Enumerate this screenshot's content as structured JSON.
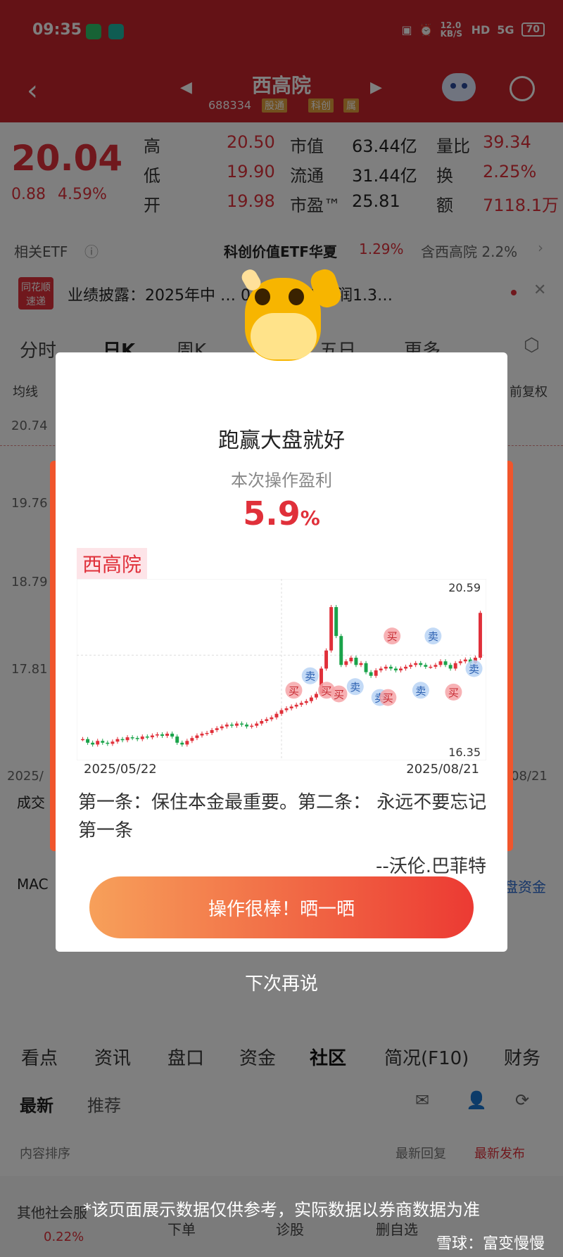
{
  "status_bar": {
    "time": "09:35",
    "net_speed": "12.0 KB/S",
    "network": "5G",
    "battery": "70"
  },
  "header": {
    "title": "西高院",
    "code": "688334",
    "tags": [
      "股通",
      "科创",
      "属"
    ]
  },
  "quote": {
    "price": "20.04",
    "change": "0.88",
    "change_pct": "4.59%",
    "rows": [
      {
        "l1": "高",
        "v1": "20.50",
        "l2": "市值",
        "v2": "63.44亿",
        "l3": "量比",
        "v3": "39.34"
      },
      {
        "l1": "低",
        "v1": "19.90",
        "l2": "流通",
        "v2": "31.44亿",
        "l3": "换",
        "v3": "2.25%"
      },
      {
        "l1": "开",
        "v1": "19.98",
        "l2": "市盈™",
        "v2": "25.81",
        "l3": "额",
        "v3": "7118.1万"
      }
    ]
  },
  "etf": {
    "label": "相关ETF",
    "name": "科创价值ETF华夏",
    "pct": "1.29%",
    "hold": "含西高院  2.2%"
  },
  "news": {
    "logo": "同花顺 速递",
    "text": "业绩披露：2025年中 … 0.42元，净利润1.3…"
  },
  "ktabs": [
    "分时",
    "日K",
    "周K",
    "五日",
    "更多"
  ],
  "sub": {
    "left": "均线",
    "right": "前复权"
  },
  "bg_axis": [
    "20.74",
    "19.76",
    "18.79",
    "17.81"
  ],
  "bg_left_labels": {
    "date": "2025/",
    "volume": "成交",
    "macd": "MAC"
  },
  "bg_right_labels": {
    "date": "08/21",
    "fund": "盘资金"
  },
  "bottom_tabs": [
    "看点",
    "资讯",
    "盘口",
    "资金",
    "社区",
    "简况(F10)",
    "财务"
  ],
  "community": {
    "tabs": [
      "最新",
      "推荐"
    ],
    "order_label": "内容排序",
    "order_a": "最新回复",
    "order_b": "最新发布"
  },
  "footer": {
    "left": "其他社会服",
    "left_pct": "0.22%",
    "items": [
      "下单",
      "诊股",
      "删自选"
    ]
  },
  "modal": {
    "title": "跑赢大盘就好",
    "subtitle": "本次操作盈利",
    "pct_value": "5.9",
    "pct_sign": "%",
    "stock_name": "西高院",
    "chart_high": "20.59",
    "chart_low": "16.35",
    "date_start": "2025/05/22",
    "date_end": "2025/08/21",
    "quote": "第一条：保住本金最重要。第二条： 永远不要忘记第一条",
    "author": "--沃伦.巴菲特",
    "share_button": "操作很棒！晒一晒",
    "dismiss": "下次再说",
    "marker_buy": "买",
    "marker_sell": "卖"
  },
  "disclaimer": "*该页面展示数据仅供参考，实际数据以券商数据为准",
  "watermark": "雪球：富变慢慢",
  "colors": {
    "brand_red": "#c8242c",
    "up": "#e0303a",
    "down": "#1aa34a"
  },
  "chart_data": {
    "type": "candlestick",
    "title": "西高院",
    "x_range": [
      "2025/05/22",
      "2025/08/21"
    ],
    "ylim": [
      16.35,
      20.59
    ],
    "closes": [
      16.55,
      16.45,
      16.4,
      16.5,
      16.45,
      16.42,
      16.48,
      16.55,
      16.52,
      16.6,
      16.58,
      16.55,
      16.62,
      16.6,
      16.65,
      16.68,
      16.64,
      16.7,
      16.62,
      16.45,
      16.4,
      16.5,
      16.58,
      16.65,
      16.7,
      16.72,
      16.8,
      16.85,
      16.9,
      16.95,
      16.92,
      16.98,
      16.95,
      16.9,
      16.92,
      16.98,
      17.05,
      17.1,
      17.15,
      17.25,
      17.35,
      17.4,
      17.45,
      17.5,
      17.55,
      17.6,
      17.7,
      17.8,
      18.5,
      19.0,
      20.2,
      19.4,
      18.6,
      18.7,
      18.8,
      18.6,
      18.65,
      18.4,
      18.3,
      18.45,
      18.5,
      18.55,
      18.5,
      18.45,
      18.5,
      18.55,
      18.6,
      18.65,
      18.6,
      18.55,
      18.55,
      18.6,
      18.7,
      18.6,
      18.5,
      18.65,
      18.7,
      18.75,
      18.65,
      18.8,
      20.04
    ],
    "markers": [
      {
        "type": "买",
        "x": "",
        "y": 17.9
      },
      {
        "type": "卖",
        "x": "",
        "y": 18.3
      },
      {
        "type": "卖",
        "x": "",
        "y": 18.0
      },
      {
        "type": "卖",
        "x": "",
        "y": 17.7
      },
      {
        "type": "买",
        "x": "",
        "y": 19.4
      },
      {
        "type": "买",
        "x": "",
        "y": 17.8
      },
      {
        "type": "买",
        "x": "",
        "y": 17.7
      },
      {
        "type": "买",
        "x": "",
        "y": 17.9
      },
      {
        "type": "卖",
        "x": "",
        "y": 19.4
      },
      {
        "type": "卖",
        "x": "",
        "y": 17.9
      },
      {
        "type": "买",
        "x": "",
        "y": 17.85
      },
      {
        "type": "卖",
        "x": "",
        "y": 18.5
      }
    ]
  }
}
